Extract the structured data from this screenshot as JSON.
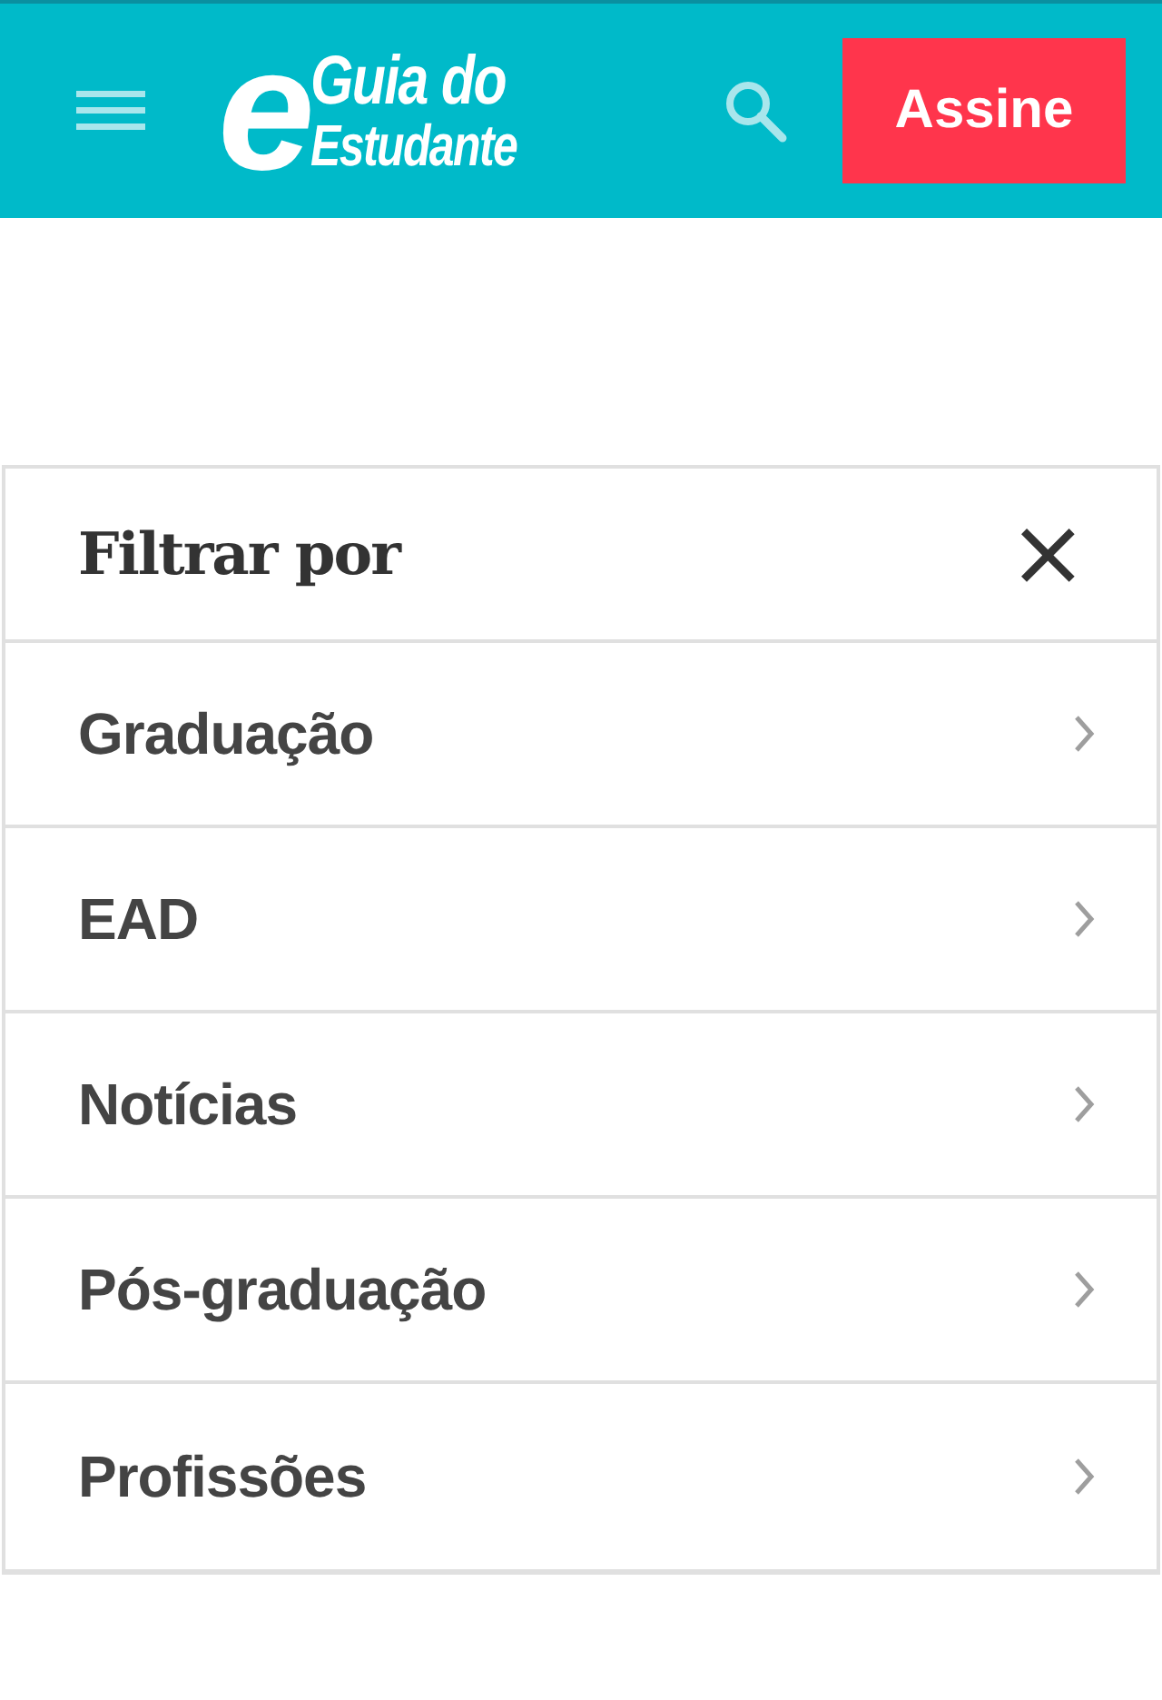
{
  "header": {
    "logo": {
      "mark": "e",
      "line_1": "Guia do",
      "line_2": "Estudante"
    },
    "subscribe_button": "Assine"
  },
  "filter_panel": {
    "title": "Filtrar por",
    "close": "×",
    "items": [
      {
        "label": "Graduação"
      },
      {
        "label": "EAD"
      },
      {
        "label": "Notícias"
      },
      {
        "label": "Pós-graduação"
      },
      {
        "label": "Profissões"
      }
    ]
  }
}
